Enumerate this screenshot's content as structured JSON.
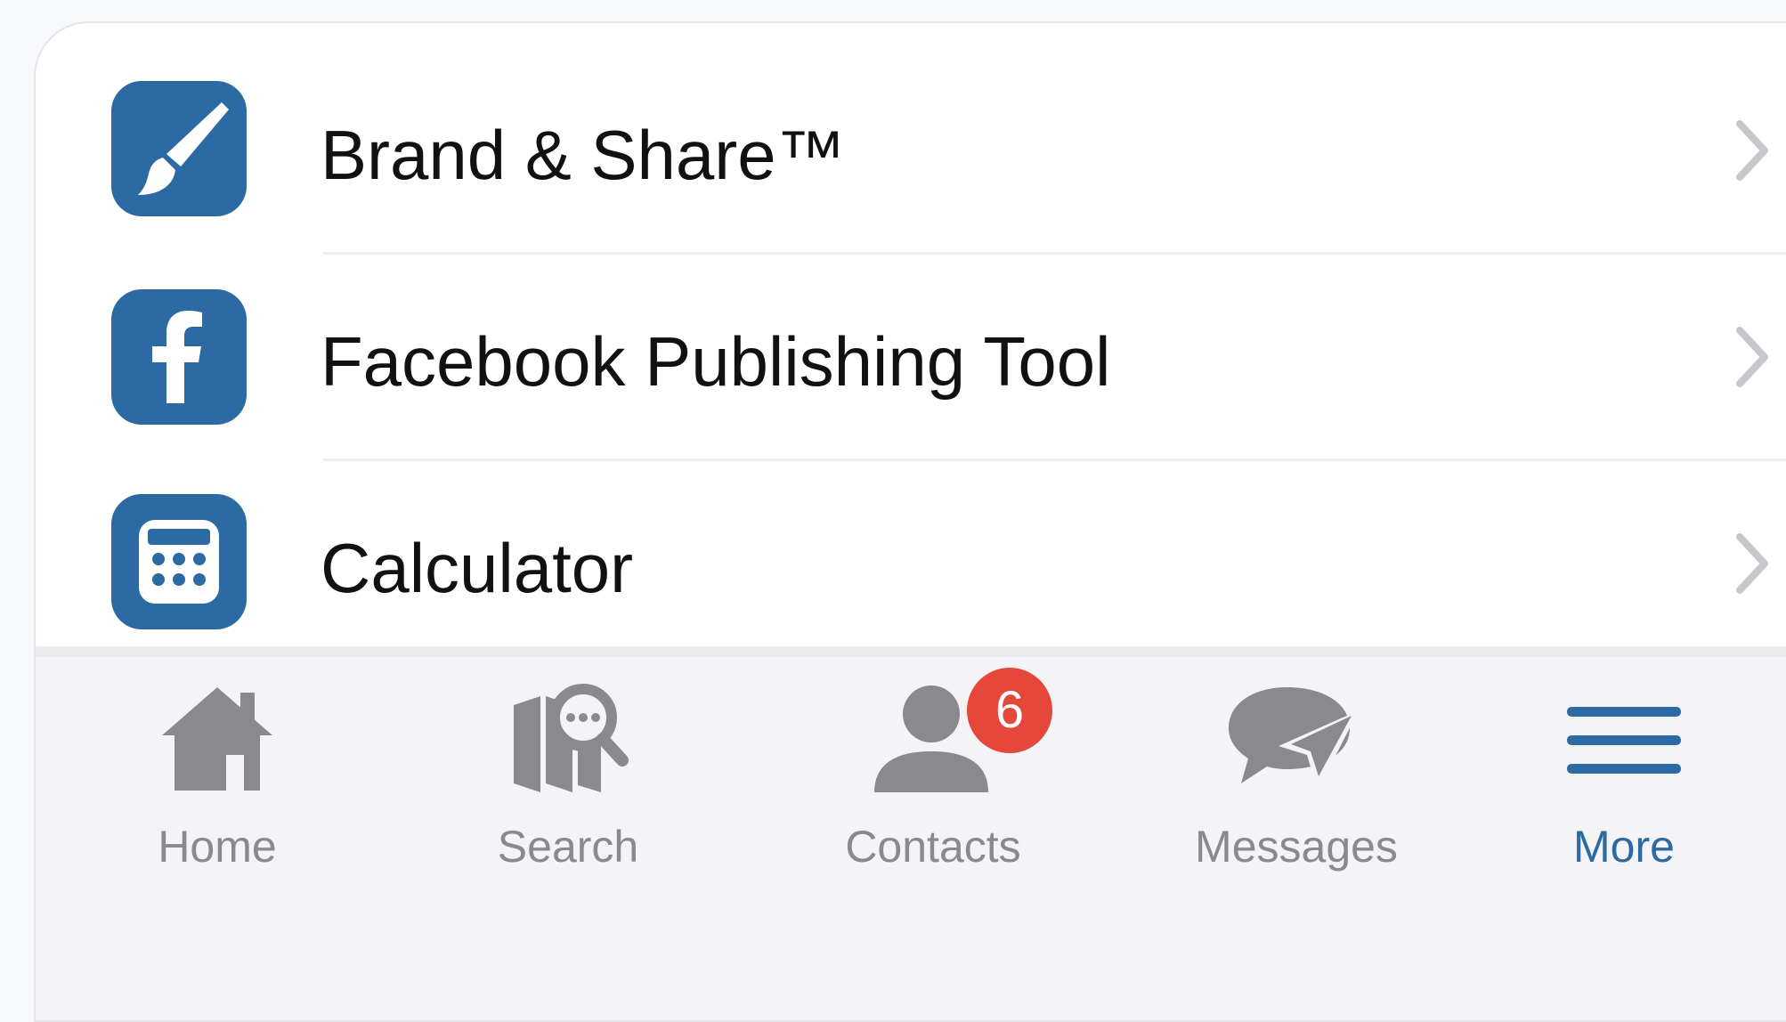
{
  "menu": {
    "items": [
      {
        "label": "Brand & Share™",
        "icon": "paintbrush-icon"
      },
      {
        "label": "Facebook Publishing Tool",
        "icon": "facebook-icon"
      },
      {
        "label": "Calculator",
        "icon": "calculator-icon"
      }
    ]
  },
  "tabbar": {
    "tabs": [
      {
        "label": "Home",
        "icon": "home-icon"
      },
      {
        "label": "Search",
        "icon": "map-search-icon"
      },
      {
        "label": "Contacts",
        "icon": "contacts-icon",
        "badge": "6"
      },
      {
        "label": "Messages",
        "icon": "messages-icon"
      },
      {
        "label": "More",
        "icon": "menu-icon",
        "active": true
      }
    ]
  },
  "colors": {
    "brand": "#2b6aa2",
    "badge": "#e5473b",
    "inactive": "#8a8a8e"
  }
}
